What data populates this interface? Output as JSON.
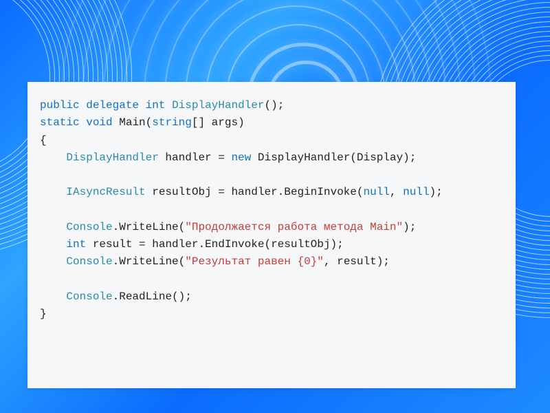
{
  "code": {
    "line1": {
      "kw_public": "public",
      "kw_delegate": "delegate",
      "kw_int": "int",
      "type_handler": "DisplayHandler",
      "rest": "();"
    },
    "line2": {
      "kw_static": "static",
      "kw_void": "void",
      "fn_main": "Main",
      "open": "(",
      "kw_string": "string",
      "arr": "[]",
      "param": " args",
      "close": ")"
    },
    "line3": {
      "brace": "{"
    },
    "line4": {
      "indent": "    ",
      "type": "DisplayHandler",
      "var": " handler = ",
      "kw_new": "new",
      "ctor": " DisplayHandler(Display);"
    },
    "line5_blank": "",
    "line6": {
      "indent": "    ",
      "type": "IAsyncResult",
      "var": " resultObj = handler.BeginInvoke(",
      "kw_null1": "null",
      "comma": ", ",
      "kw_null2": "null",
      "close": ");"
    },
    "line7_blank": "",
    "line8": {
      "indent": "    ",
      "console": "Console",
      "call": ".WriteLine(",
      "str": "\"Продолжается работа метода Main\"",
      "close": ");"
    },
    "line9": {
      "indent": "    ",
      "kw_int": "int",
      "rest": " result = handler.EndInvoke(resultObj);"
    },
    "line10": {
      "indent": "    ",
      "console": "Console",
      "call": ".WriteLine(",
      "str": "\"Результат равен {0}\"",
      "rest": ", result);"
    },
    "line11_blank": "",
    "line12": {
      "indent": "    ",
      "console": "Console",
      "call": ".ReadLine();"
    },
    "line13": {
      "brace": "}"
    }
  }
}
